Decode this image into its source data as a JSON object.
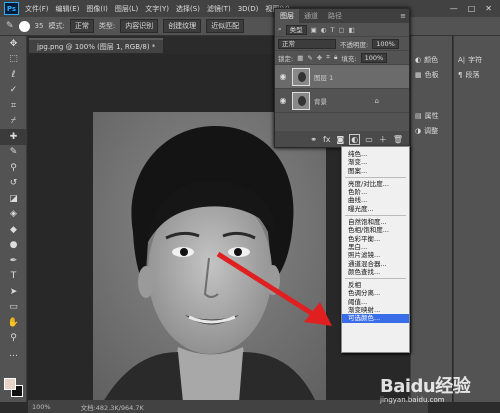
{
  "menubar": {
    "logo": "Ps",
    "items": [
      "文件(F)",
      "编辑(E)",
      "图像(I)",
      "图层(L)",
      "文字(Y)",
      "选择(S)",
      "滤镜(T)",
      "3D(D)",
      "视图(V)"
    ],
    "window_controls": [
      "—",
      "□",
      "✕"
    ]
  },
  "options": {
    "size": "35",
    "mode_label": "模式:",
    "mode_value": "正常",
    "type_label": "类型:",
    "content_aware": "内容识别",
    "create_texture": "创建纹理",
    "proximity": "近似匹配"
  },
  "document": {
    "tab": "jpg.png @ 100% (图层 1, RGB/8) *",
    "zoom": "100%",
    "doc_size": "文档:482.3K/964.7K"
  },
  "layers_panel": {
    "tabs": [
      "图层",
      "通道",
      "路径"
    ],
    "kind_filter": "类型",
    "blend_mode": "正常",
    "opacity_label": "不透明度:",
    "opacity_value": "100%",
    "lock_label": "锁定:",
    "fill_label": "填充:",
    "fill_value": "100%",
    "layers": [
      {
        "name": "图层 1",
        "selected": true
      },
      {
        "name": "背景",
        "selected": false
      }
    ]
  },
  "right_dock": {
    "items": [
      "颜色",
      "色板",
      "属性",
      "调整"
    ],
    "items2": [
      "字符",
      "段落"
    ]
  },
  "adjustment_menu": {
    "groups": [
      [
        "纯色...",
        "渐变...",
        "图案..."
      ],
      [
        "亮度/对比度...",
        "色阶...",
        "曲线...",
        "曝光度..."
      ],
      [
        "自然饱和度...",
        "色相/饱和度...",
        "色彩平衡...",
        "黑白...",
        "照片滤镜...",
        "通道混合器...",
        "颜色查找..."
      ],
      [
        "反相",
        "色调分离...",
        "阈值...",
        "渐变映射...",
        "可选颜色..."
      ]
    ],
    "highlighted": "可选颜色..."
  },
  "watermark": {
    "brand": "Baidu经验",
    "url": "jingyan.baidu.com"
  },
  "colors": {
    "accent_highlight": "#3a6ee8",
    "arrow": "#e02020"
  }
}
